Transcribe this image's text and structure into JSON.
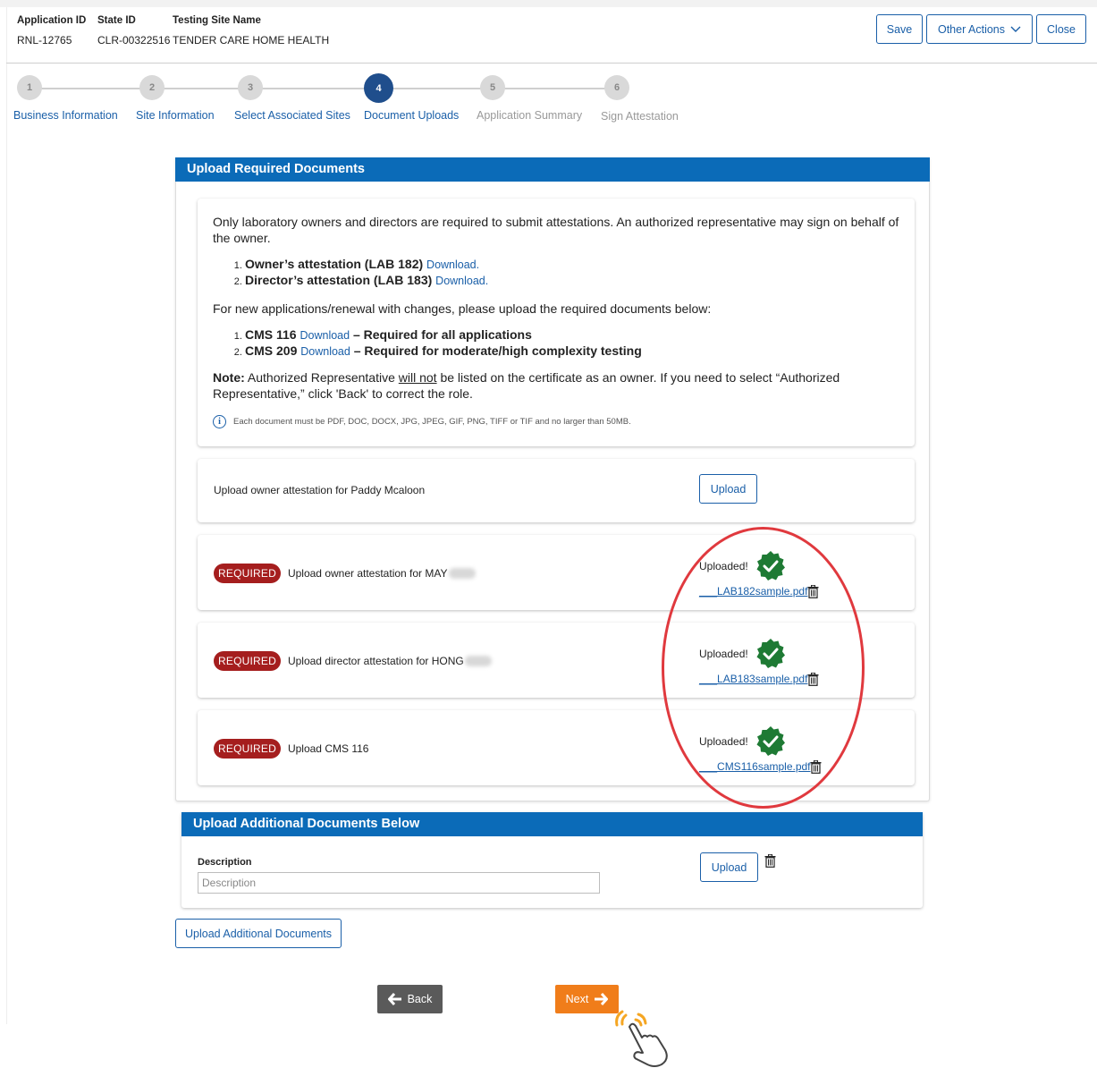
{
  "header": {
    "application_id_label": "Application ID",
    "application_id": "RNL-12765",
    "state_id_label": "State ID",
    "state_id": "CLR-00322516",
    "site_name_label": "Testing Site Name",
    "site_name": "TENDER CARE HOME HEALTH",
    "save_label": "Save",
    "other_actions_label": "Other Actions",
    "close_label": "Close"
  },
  "steps": [
    {
      "number": "1",
      "label": "Business Information",
      "state": "done"
    },
    {
      "number": "2",
      "label": "Site Information",
      "state": "done"
    },
    {
      "number": "3",
      "label": "Select Associated Sites",
      "state": "done"
    },
    {
      "number": "4",
      "label": "Document Uploads",
      "state": "active"
    },
    {
      "number": "5",
      "label": "Application Summary",
      "state": "future"
    },
    {
      "number": "6",
      "label": "Sign Attestation",
      "state": "future"
    }
  ],
  "required_section": {
    "title": "Upload Required Documents",
    "intro": "Only laboratory owners and directors are required to submit attestations. An authorized representative may sign on behalf of the owner.",
    "attestations": [
      {
        "name": "Owner’s attestation (LAB 182)",
        "link": "Download."
      },
      {
        "name": "Director’s attestation (LAB 183)",
        "link": "Download."
      }
    ],
    "new_apps_text": "For new applications/renewal with changes, please upload the required documents below:",
    "required_docs": [
      {
        "name": "CMS 116",
        "link": "Download",
        "note": "– Required for all applications"
      },
      {
        "name": "CMS 209",
        "link": "Download",
        "note": "– Required for moderate/high complexity testing"
      }
    ],
    "note_label": "Note:",
    "note_pre": " Authorized Representative ",
    "note_underline": "will not",
    "note_post": " be listed on the certificate as an owner. If you need to select “Authorized Representative,” click 'Back' to correct the role.",
    "file_rules": "Each document must be PDF, DOC, DOCX, JPG, JPEG, GIF, PNG, TIFF or TIF and no larger than 50MB.",
    "rows": [
      {
        "required": false,
        "text": "Upload owner attestation for Paddy Mcaloon",
        "upload_label": "Upload"
      },
      {
        "required": true,
        "badge": "REQUIRED",
        "text": "Upload owner attestation for MAY",
        "status": "Uploaded!",
        "file": "___LAB182sample.pdf"
      },
      {
        "required": true,
        "badge": "REQUIRED",
        "text": "Upload director attestation for HONG",
        "status": "Uploaded!",
        "file": "___LAB183sample.pdf"
      },
      {
        "required": true,
        "badge": "REQUIRED",
        "text": "Upload CMS 116",
        "status": "Uploaded!",
        "file": "___CMS116sample.pdf"
      }
    ]
  },
  "additional_section": {
    "title": "Upload Additional Documents Below",
    "description_label": "Description",
    "description_placeholder": "Description",
    "description_value": "",
    "upload_label": "Upload",
    "add_more_label": "Upload Additional Documents"
  },
  "footer": {
    "back_label": "Back",
    "next_label": "Next"
  },
  "colors": {
    "primary_blue": "#0b6bb8",
    "link_blue": "#1a5fa8",
    "required_red": "#a51e1e",
    "next_orange": "#f07d1a",
    "back_grey": "#5a5a5a",
    "success_green": "#1e7a34",
    "highlight_red": "#e0393e"
  }
}
